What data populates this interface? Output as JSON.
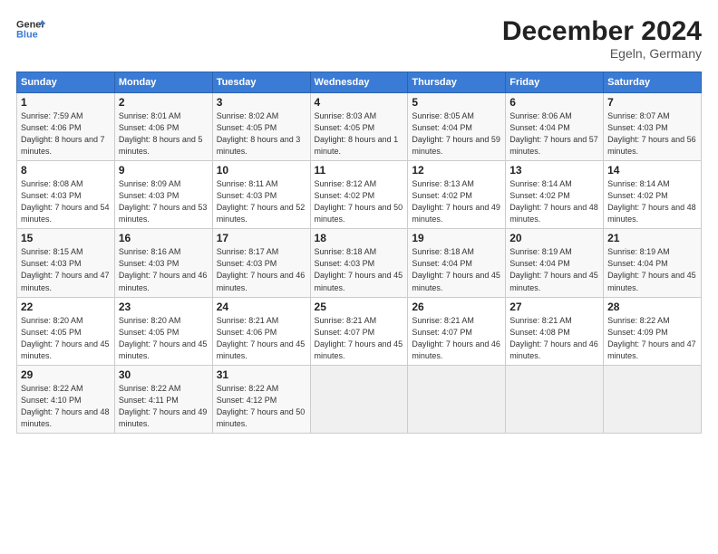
{
  "header": {
    "logo_line1": "General",
    "logo_line2": "Blue",
    "month": "December 2024",
    "location": "Egeln, Germany"
  },
  "days_of_week": [
    "Sunday",
    "Monday",
    "Tuesday",
    "Wednesday",
    "Thursday",
    "Friday",
    "Saturday"
  ],
  "weeks": [
    [
      {
        "num": "1",
        "rise": "Sunrise: 7:59 AM",
        "set": "Sunset: 4:06 PM",
        "daylight": "Daylight: 8 hours and 7 minutes."
      },
      {
        "num": "2",
        "rise": "Sunrise: 8:01 AM",
        "set": "Sunset: 4:06 PM",
        "daylight": "Daylight: 8 hours and 5 minutes."
      },
      {
        "num": "3",
        "rise": "Sunrise: 8:02 AM",
        "set": "Sunset: 4:05 PM",
        "daylight": "Daylight: 8 hours and 3 minutes."
      },
      {
        "num": "4",
        "rise": "Sunrise: 8:03 AM",
        "set": "Sunset: 4:05 PM",
        "daylight": "Daylight: 8 hours and 1 minute."
      },
      {
        "num": "5",
        "rise": "Sunrise: 8:05 AM",
        "set": "Sunset: 4:04 PM",
        "daylight": "Daylight: 7 hours and 59 minutes."
      },
      {
        "num": "6",
        "rise": "Sunrise: 8:06 AM",
        "set": "Sunset: 4:04 PM",
        "daylight": "Daylight: 7 hours and 57 minutes."
      },
      {
        "num": "7",
        "rise": "Sunrise: 8:07 AM",
        "set": "Sunset: 4:03 PM",
        "daylight": "Daylight: 7 hours and 56 minutes."
      }
    ],
    [
      {
        "num": "8",
        "rise": "Sunrise: 8:08 AM",
        "set": "Sunset: 4:03 PM",
        "daylight": "Daylight: 7 hours and 54 minutes."
      },
      {
        "num": "9",
        "rise": "Sunrise: 8:09 AM",
        "set": "Sunset: 4:03 PM",
        "daylight": "Daylight: 7 hours and 53 minutes."
      },
      {
        "num": "10",
        "rise": "Sunrise: 8:11 AM",
        "set": "Sunset: 4:03 PM",
        "daylight": "Daylight: 7 hours and 52 minutes."
      },
      {
        "num": "11",
        "rise": "Sunrise: 8:12 AM",
        "set": "Sunset: 4:02 PM",
        "daylight": "Daylight: 7 hours and 50 minutes."
      },
      {
        "num": "12",
        "rise": "Sunrise: 8:13 AM",
        "set": "Sunset: 4:02 PM",
        "daylight": "Daylight: 7 hours and 49 minutes."
      },
      {
        "num": "13",
        "rise": "Sunrise: 8:14 AM",
        "set": "Sunset: 4:02 PM",
        "daylight": "Daylight: 7 hours and 48 minutes."
      },
      {
        "num": "14",
        "rise": "Sunrise: 8:14 AM",
        "set": "Sunset: 4:02 PM",
        "daylight": "Daylight: 7 hours and 48 minutes."
      }
    ],
    [
      {
        "num": "15",
        "rise": "Sunrise: 8:15 AM",
        "set": "Sunset: 4:03 PM",
        "daylight": "Daylight: 7 hours and 47 minutes."
      },
      {
        "num": "16",
        "rise": "Sunrise: 8:16 AM",
        "set": "Sunset: 4:03 PM",
        "daylight": "Daylight: 7 hours and 46 minutes."
      },
      {
        "num": "17",
        "rise": "Sunrise: 8:17 AM",
        "set": "Sunset: 4:03 PM",
        "daylight": "Daylight: 7 hours and 46 minutes."
      },
      {
        "num": "18",
        "rise": "Sunrise: 8:18 AM",
        "set": "Sunset: 4:03 PM",
        "daylight": "Daylight: 7 hours and 45 minutes."
      },
      {
        "num": "19",
        "rise": "Sunrise: 8:18 AM",
        "set": "Sunset: 4:04 PM",
        "daylight": "Daylight: 7 hours and 45 minutes."
      },
      {
        "num": "20",
        "rise": "Sunrise: 8:19 AM",
        "set": "Sunset: 4:04 PM",
        "daylight": "Daylight: 7 hours and 45 minutes."
      },
      {
        "num": "21",
        "rise": "Sunrise: 8:19 AM",
        "set": "Sunset: 4:04 PM",
        "daylight": "Daylight: 7 hours and 45 minutes."
      }
    ],
    [
      {
        "num": "22",
        "rise": "Sunrise: 8:20 AM",
        "set": "Sunset: 4:05 PM",
        "daylight": "Daylight: 7 hours and 45 minutes."
      },
      {
        "num": "23",
        "rise": "Sunrise: 8:20 AM",
        "set": "Sunset: 4:05 PM",
        "daylight": "Daylight: 7 hours and 45 minutes."
      },
      {
        "num": "24",
        "rise": "Sunrise: 8:21 AM",
        "set": "Sunset: 4:06 PM",
        "daylight": "Daylight: 7 hours and 45 minutes."
      },
      {
        "num": "25",
        "rise": "Sunrise: 8:21 AM",
        "set": "Sunset: 4:07 PM",
        "daylight": "Daylight: 7 hours and 45 minutes."
      },
      {
        "num": "26",
        "rise": "Sunrise: 8:21 AM",
        "set": "Sunset: 4:07 PM",
        "daylight": "Daylight: 7 hours and 46 minutes."
      },
      {
        "num": "27",
        "rise": "Sunrise: 8:21 AM",
        "set": "Sunset: 4:08 PM",
        "daylight": "Daylight: 7 hours and 46 minutes."
      },
      {
        "num": "28",
        "rise": "Sunrise: 8:22 AM",
        "set": "Sunset: 4:09 PM",
        "daylight": "Daylight: 7 hours and 47 minutes."
      }
    ],
    [
      {
        "num": "29",
        "rise": "Sunrise: 8:22 AM",
        "set": "Sunset: 4:10 PM",
        "daylight": "Daylight: 7 hours and 48 minutes."
      },
      {
        "num": "30",
        "rise": "Sunrise: 8:22 AM",
        "set": "Sunset: 4:11 PM",
        "daylight": "Daylight: 7 hours and 49 minutes."
      },
      {
        "num": "31",
        "rise": "Sunrise: 8:22 AM",
        "set": "Sunset: 4:12 PM",
        "daylight": "Daylight: 7 hours and 50 minutes."
      },
      null,
      null,
      null,
      null
    ]
  ]
}
